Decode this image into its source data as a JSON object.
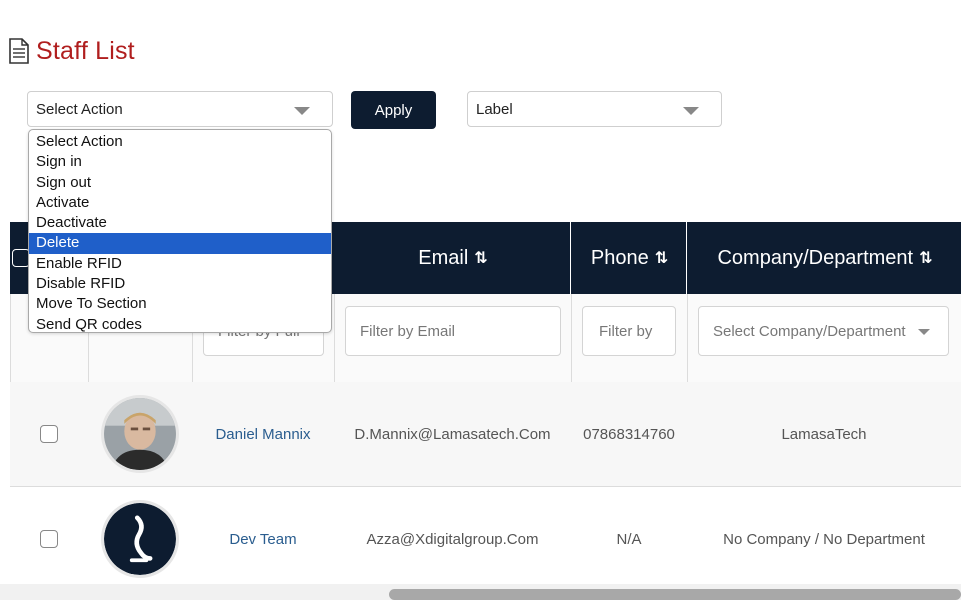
{
  "page": {
    "title": "Staff List"
  },
  "toolbar": {
    "action_select_value": "Select Action",
    "apply_label": "Apply",
    "label_select_value": "Label"
  },
  "action_menu": {
    "options": [
      "Select Action",
      "Sign in",
      "Sign out",
      "Activate",
      "Deactivate",
      "Delete",
      "Enable RFID",
      "Disable RFID",
      "Move To Section",
      "Send QR codes"
    ],
    "highlighted": "Delete"
  },
  "table": {
    "headers": {
      "email": "Email",
      "phone": "Phone",
      "company": "Company/Department"
    },
    "sort_icon": "⇅",
    "filters": {
      "name_placeholder": "Filter by Full",
      "email_placeholder": "Filter by Email",
      "phone_placeholder": "Filter by",
      "company_placeholder": "Select Company/Department"
    },
    "rows": [
      {
        "name": "Daniel Mannix",
        "email": "D.Mannix@Lamasatech.Com",
        "phone": "07868314760",
        "company": "LamasaTech",
        "avatar": "photo-avatar"
      },
      {
        "name": "Dev Team",
        "email": "Azza@Xdigitalgroup.Com",
        "phone": "N/A",
        "company": "No Company / No Department",
        "avatar": "logo-avatar"
      }
    ]
  },
  "colors": {
    "title": "#b01e1e",
    "header_bg": "#0d1c30",
    "highlight": "#1f5fc9",
    "link": "#2a5d8f"
  }
}
